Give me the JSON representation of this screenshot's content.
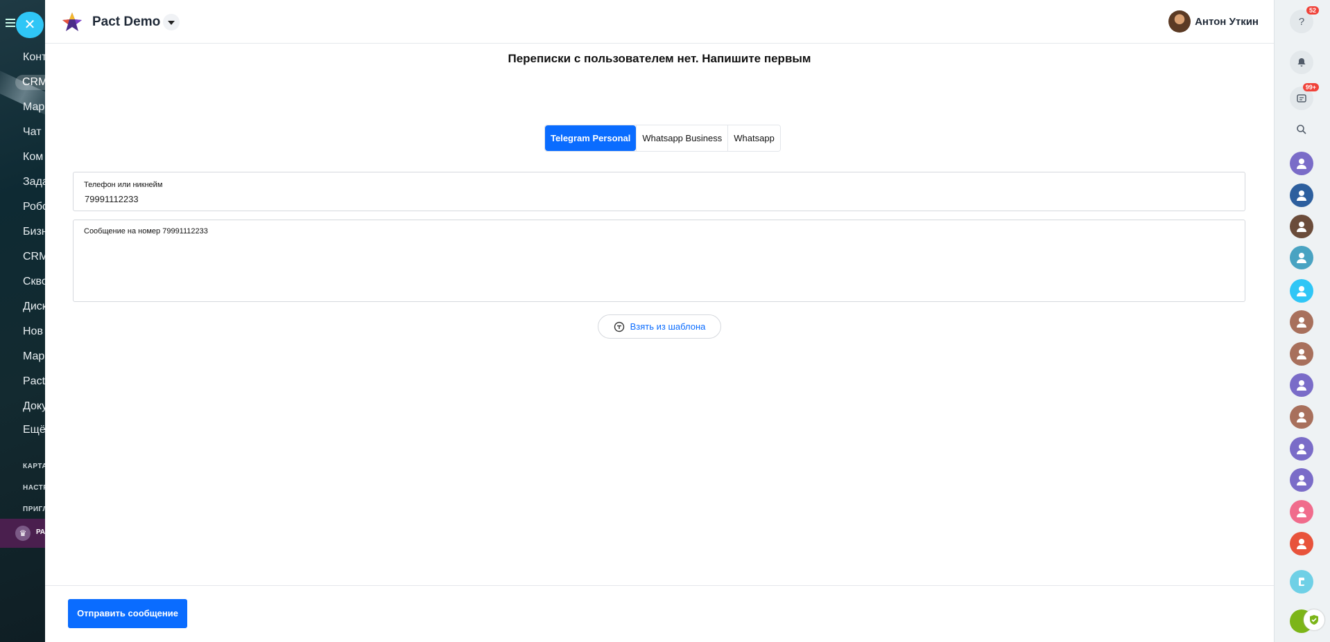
{
  "background_menu": {
    "items": [
      "Конт",
      "CRM",
      "Мар",
      "Чат",
      "Ком",
      "Зада",
      "Робо",
      "Бизн",
      "CRM",
      "Скво",
      "Диск",
      "Нов",
      "Мар",
      "Pact",
      "Доку",
      "Ещё"
    ],
    "active_index": 1,
    "small_items": [
      "КАРТА",
      "НАСТР",
      "ПРИГЛ"
    ],
    "banner_text": "РА"
  },
  "header": {
    "app_title": "Pact Demo",
    "user_name": "Антон Уткин"
  },
  "main": {
    "empty_message": "Переписки с пользователем нет. Напишите первым",
    "channels": [
      "Telegram Personal",
      "Whatsapp Business",
      "Whatsapp"
    ],
    "active_channel_index": 0,
    "phone_field": {
      "label": "Телефон или никнейм",
      "value": "79991112233"
    },
    "message_field": {
      "label": "Сообщение на номер 79991112233",
      "value": ""
    },
    "template_button": "Взять из шаблона"
  },
  "footer": {
    "send_button": "Отправить сообщение"
  },
  "rightbar": {
    "help_badge": "52",
    "chat_badge": "99+",
    "avatar_colors": [
      "#7a6cc8",
      "#2d5f9e",
      "#6b4c3a",
      "#49a3c2",
      "#2fc6f6",
      "#a8705c",
      "#a8705c",
      "#7a6cc8",
      "#a8705c",
      "#7a6cc8",
      "#7a6cc8",
      "#f06c8c",
      "#e8533b"
    ],
    "accent": "#0a6cff"
  }
}
